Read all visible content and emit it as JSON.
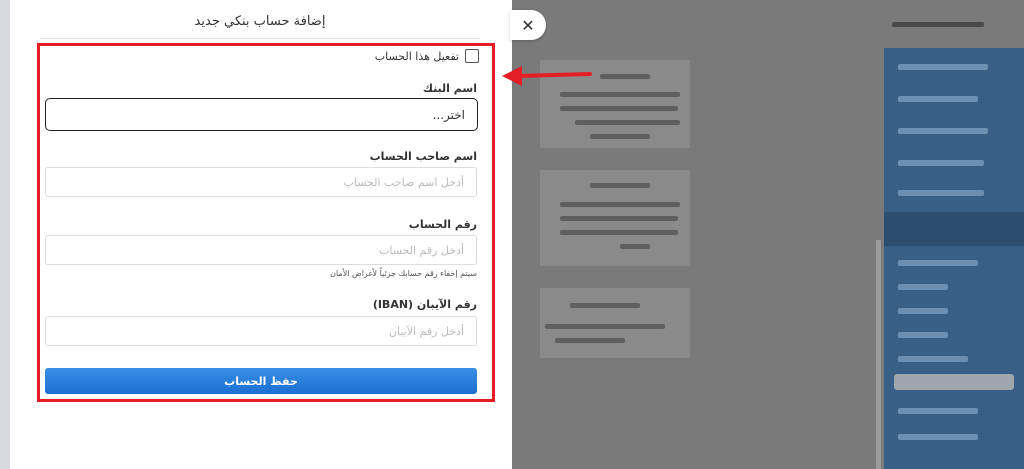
{
  "modal": {
    "title": "إضافة حساب بنكي جديد",
    "activate_label": "تفعيل هذا الحساب",
    "bank": {
      "label": "اسم البنك",
      "value": "اختر..."
    },
    "holder": {
      "label": "اسم صاحب الحساب",
      "placeholder": "أدخل اسم صاحب الحساب"
    },
    "account": {
      "label": "رقم الحساب",
      "placeholder": "أدخل رقم الحساب",
      "helper": "سيتم إخفاء رقم حسابك جزئياً لأغراض الأمان"
    },
    "iban": {
      "label": "رقم الآيبان (IBAN)",
      "placeholder": "أدخل رقم الآيبان"
    },
    "save_label": "حفظ الحساب"
  },
  "close_glyph": "✕",
  "colors": {
    "highlight": "#e31e24",
    "primary": "#1a6fd2"
  }
}
